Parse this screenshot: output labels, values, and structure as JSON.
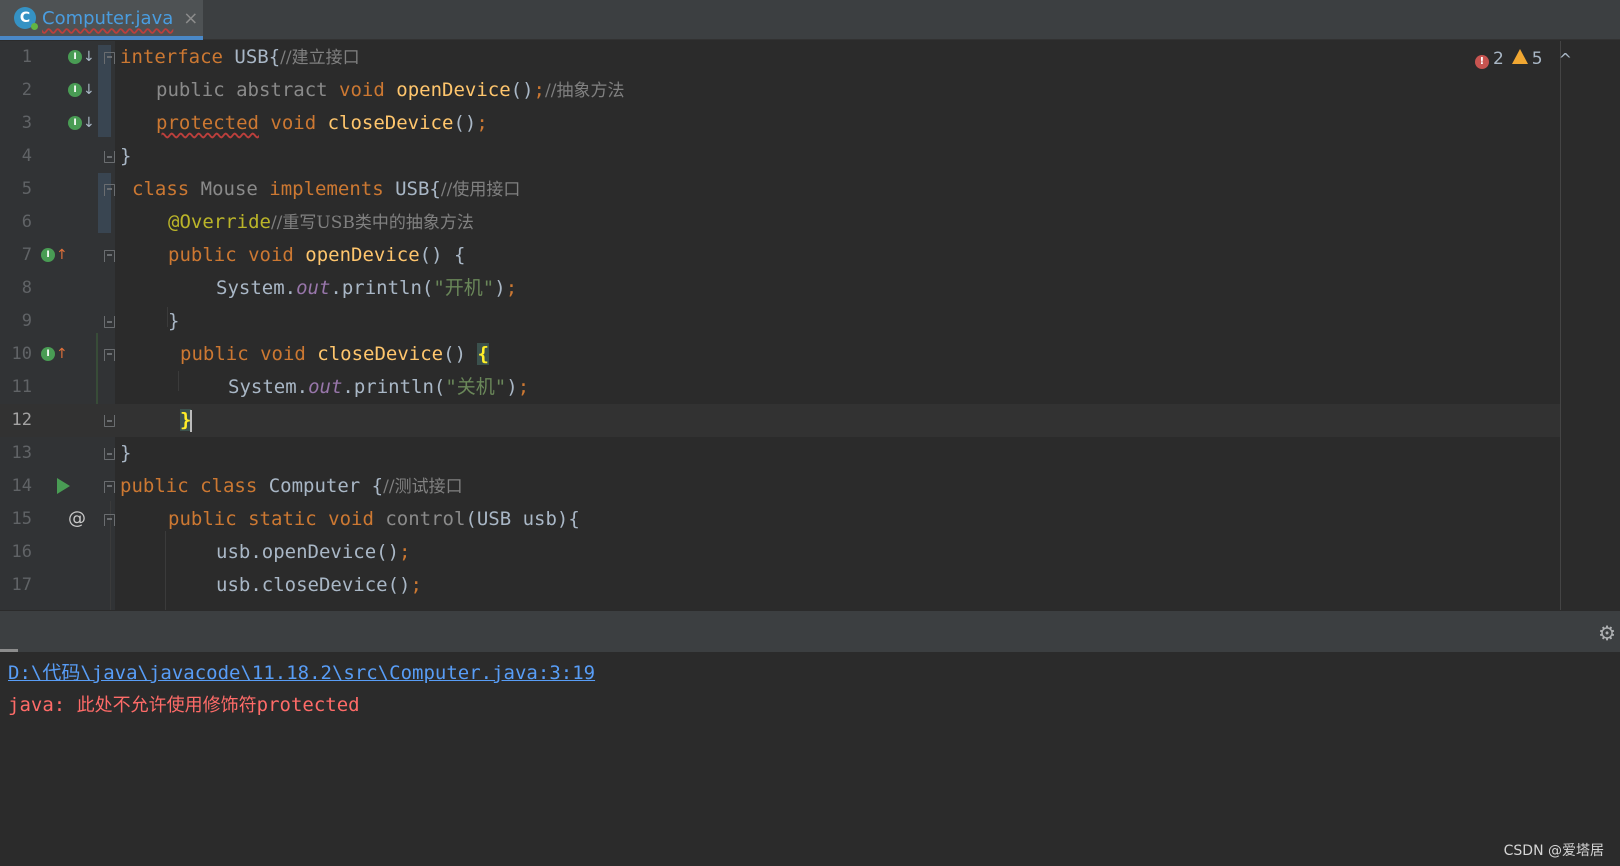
{
  "tab": {
    "icon": "C",
    "title": "Computer.java",
    "close": "×"
  },
  "inspection": {
    "errors": "2",
    "warnings": "5"
  },
  "lines": {
    "1": "1",
    "2": "2",
    "3": "3",
    "4": "4",
    "5": "5",
    "6": "6",
    "7": "7",
    "8": "8",
    "9": "9",
    "10": "10",
    "11": "11",
    "12": "12",
    "13": "13",
    "14": "14",
    "15": "15",
    "16": "16",
    "17": "17"
  },
  "code": {
    "l1": {
      "kw": "interface",
      "name": " USB{",
      "comment": "//建立接口"
    },
    "l2": {
      "mods": "public abstract ",
      "type": "void",
      "fn": "openDevice",
      "rest": "()",
      "semi": ";",
      "comment": "//抽象方法"
    },
    "l3": {
      "kw": "protected",
      "type": " void ",
      "fn": "closeDevice",
      "rest": "()",
      "semi": ";"
    },
    "l4": {
      "text": "}"
    },
    "l5": {
      "kw1": "class",
      "name": " Mouse ",
      "kw2": "implements",
      "rest": " USB{",
      "comment": "//使用接口"
    },
    "l6": {
      "ann": "@Override",
      "comment": "//重写USB类中的抽象方法"
    },
    "l7": {
      "kw": "public void ",
      "fn": "openDevice",
      "rest": "() {"
    },
    "l8": {
      "obj": "System.",
      "field": "out",
      "call": ".println(",
      "str": "\"开机\"",
      "close": ")",
      "semi": ";"
    },
    "l9": {
      "text": "}"
    },
    "l10": {
      "kw": "public void ",
      "fn": "closeDevice",
      "rest": "() ",
      "brace": "{"
    },
    "l11": {
      "obj": "System.",
      "field": "out",
      "call": ".println(",
      "str": "\"关机\"",
      "close": ")",
      "semi": ";"
    },
    "l12": {
      "brace": "}"
    },
    "l13": {
      "text": "}"
    },
    "l14": {
      "kw": "public class ",
      "name": "Computer {",
      "comment": "//测试接口"
    },
    "l15": {
      "kw": "public static void ",
      "fn": "control",
      "rest": "(USB usb){"
    },
    "l16": {
      "text": "usb.openDevice()",
      "semi": ";"
    },
    "l17": {
      "text": "usb.closeDevice()",
      "semi": ";"
    }
  },
  "gutter_icons": {
    "impl_badge": "I",
    "at": "@"
  },
  "console": {
    "path": "D:\\代码\\java\\javacode\\11.18.2\\src\\Computer.java:3:19",
    "error_prefix": "java: ",
    "error_msg": "此处不允许使用修饰符",
    "error_kw": "protected"
  },
  "watermark": "CSDN @爱塔居",
  "colors": {
    "keyword": "#cc7832",
    "function": "#ffc66d",
    "string": "#6a8759",
    "comment": "#808080",
    "error": "#ff6b68",
    "link": "#589df6"
  }
}
